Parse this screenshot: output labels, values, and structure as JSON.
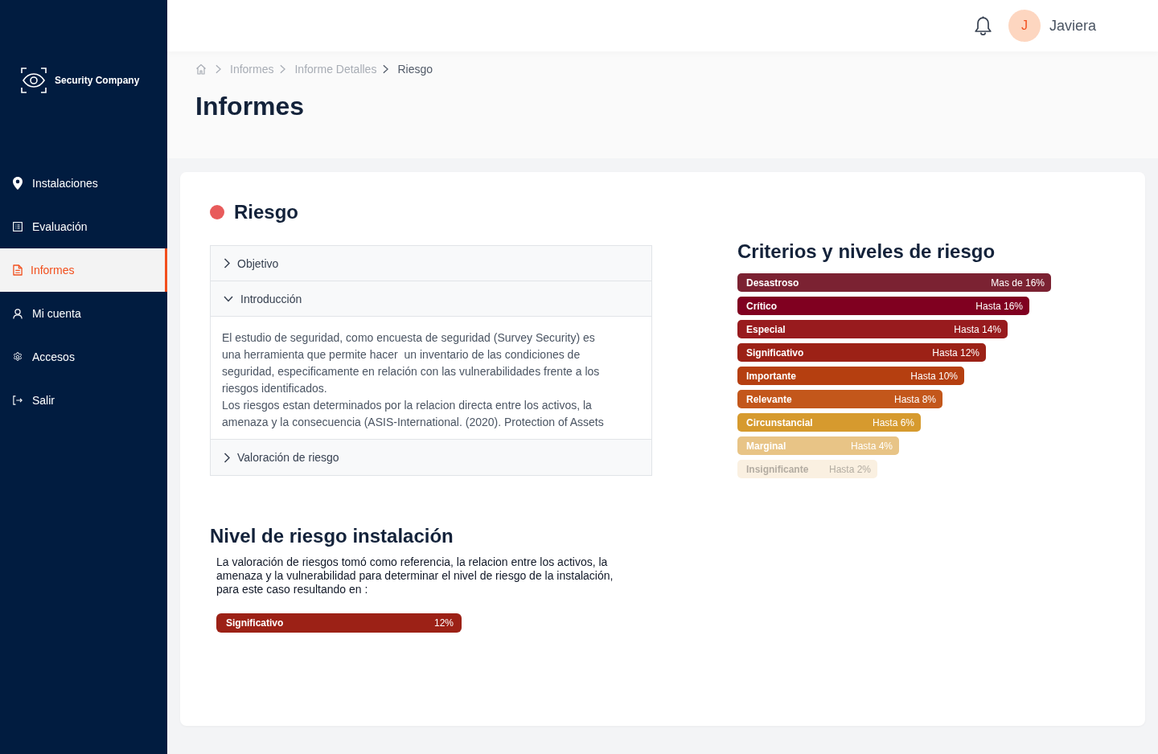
{
  "sidebar": {
    "brand": "Security Company",
    "items": [
      {
        "label": "Instalaciones",
        "selected": false
      },
      {
        "label": "Evaluación",
        "selected": false
      },
      {
        "label": "Informes",
        "selected": true
      },
      {
        "label": "Mi cuenta",
        "selected": false
      },
      {
        "label": "Accesos",
        "selected": false
      },
      {
        "label": "Salir",
        "selected": false
      }
    ]
  },
  "topbar": {
    "user": {
      "initial": "J",
      "name": "Javiera"
    }
  },
  "breadcrumb": [
    {
      "label": "Informes",
      "current": false
    },
    {
      "label": "Informe Detalles",
      "current": false
    },
    {
      "label": "Riesgo",
      "current": true
    }
  ],
  "page_title": "Informes",
  "card": {
    "title": "Riesgo",
    "accordion": [
      {
        "title": "Objetivo",
        "expanded": false
      },
      {
        "title": "Introducción",
        "expanded": true,
        "body": [
          "El estudio de seguridad, como encuesta de seguridad (Survey Security) es una herramienta que permite hacer  un inventario de las condiciones de seguridad, especificamente en relación con las vulnerabilidades frente a los riesgos identificados.",
          "Los riesgos estan determinados por la relacion directa entre los activos, la amenaza y la consecuencia (ASIS-International. (2020). Protection of Assets"
        ]
      },
      {
        "title": "Valoración de riesgo",
        "expanded": false
      }
    ],
    "criteria": {
      "title": "Criterios y niveles de riesgo",
      "levels": [
        {
          "label": "Desastroso",
          "range": "Mas de 16%",
          "color": "#7b2232"
        },
        {
          "label": "Crítico",
          "range": "Hasta 16%",
          "color": "#800020"
        },
        {
          "label": "Especial",
          "range": "Hasta 14%",
          "color": "#981b1e"
        },
        {
          "label": "Significativo",
          "range": "Hasta 12%",
          "color": "#9c2116"
        },
        {
          "label": "Importante",
          "range": "Hasta 10%",
          "color": "#b53f10"
        },
        {
          "label": "Relevante",
          "range": "Hasta 8%",
          "color": "#c3571b"
        },
        {
          "label": "Circunstancial",
          "range": "Hasta 6%",
          "color": "#d69a2e"
        },
        {
          "label": "Marginal",
          "range": "Hasta 4%",
          "color": "#e8c486"
        },
        {
          "label": "Insignificante",
          "range": "Hasta 2%",
          "color": "#faf0e1"
        }
      ]
    },
    "installation": {
      "title": "Nivel de riesgo instalación",
      "description": "La valoración de riesgos tomó como referencia, la relacion entre los activos, la amenaza y la vulnerabilidad para determinar el nivel de riesgo de la instalación, para este caso resultando en :",
      "result": {
        "label": "Significativo",
        "value": "12%",
        "color": "#9c2116"
      }
    }
  }
}
